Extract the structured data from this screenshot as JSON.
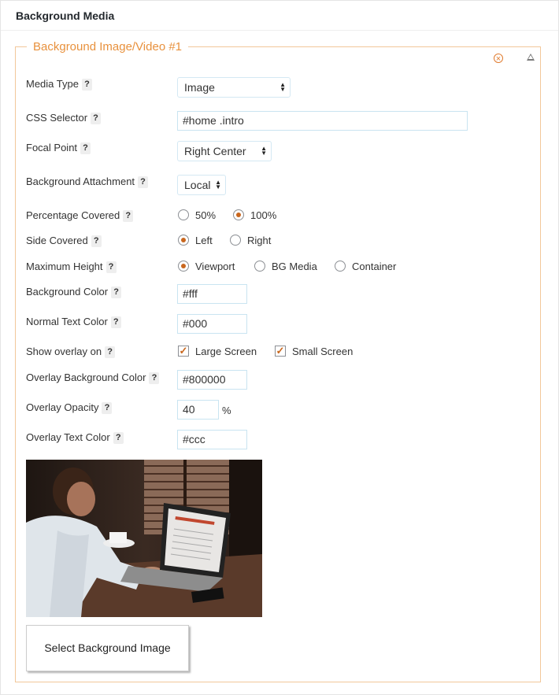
{
  "metabox": {
    "title": "Background Media"
  },
  "group": {
    "legend": "Background Image/Video #1"
  },
  "fields": {
    "media_type": {
      "label": "Media Type",
      "value": "Image"
    },
    "css_selector": {
      "label": "CSS Selector",
      "value": "#home .intro"
    },
    "focal_point": {
      "label": "Focal Point",
      "value": "Right Center"
    },
    "bg_attachment": {
      "label": "Background Attachment",
      "value": "Local"
    },
    "pct_covered": {
      "label": "Percentage Covered",
      "options": [
        "50%",
        "100%"
      ],
      "selected": "100%"
    },
    "side_covered": {
      "label": "Side Covered",
      "options": [
        "Left",
        "Right"
      ],
      "selected": "Left"
    },
    "max_height": {
      "label": "Maximum Height",
      "options": [
        "Viewport",
        "BG Media",
        "Container"
      ],
      "selected": "Viewport"
    },
    "bg_color": {
      "label": "Background Color",
      "value": "#fff"
    },
    "text_color": {
      "label": "Normal Text Color",
      "value": "#000"
    },
    "overlay_on": {
      "label": "Show overlay on",
      "options": [
        "Large Screen",
        "Small Screen"
      ],
      "checked": [
        "Large Screen",
        "Small Screen"
      ]
    },
    "overlay_bg": {
      "label": "Overlay Background Color",
      "value": "#800000"
    },
    "overlay_opacity": {
      "label": "Overlay Opacity",
      "value": "40",
      "unit": "%"
    },
    "overlay_text": {
      "label": "Overlay Text Color",
      "value": "#ccc"
    }
  },
  "help_label": "?",
  "select_button": {
    "label": "Select Background Image"
  },
  "colors": {
    "accent": "#e8913d",
    "radio_dot": "#c9671e",
    "group_border": "#f2c79a"
  }
}
